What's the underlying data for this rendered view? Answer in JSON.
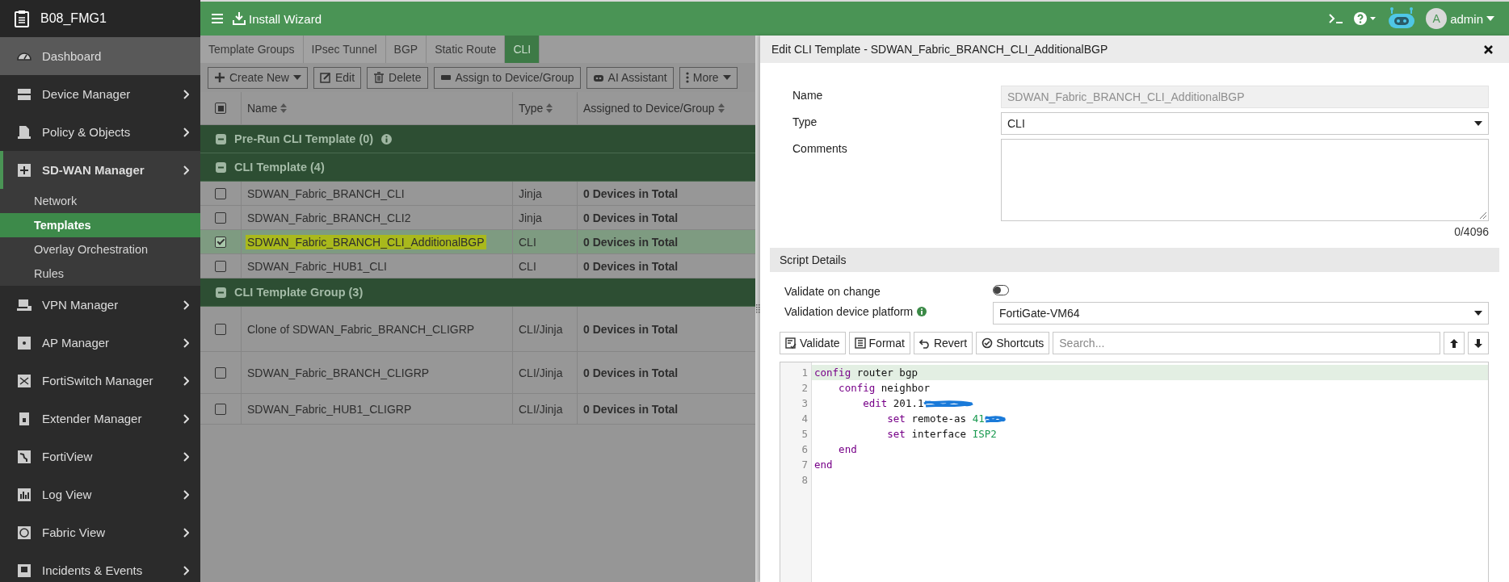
{
  "sidebar": {
    "title": "B08_FMG1",
    "items": [
      {
        "label": "Dashboard",
        "highlighted": true,
        "active": false,
        "submenu": false,
        "expanded": false
      },
      {
        "label": "Device Manager",
        "highlighted": false,
        "active": false,
        "submenu": true,
        "expanded": false
      },
      {
        "label": "Policy & Objects",
        "highlighted": false,
        "active": false,
        "submenu": true,
        "expanded": false
      },
      {
        "label": "SD-WAN Manager",
        "highlighted": false,
        "active": true,
        "submenu": true,
        "expanded": true,
        "children": [
          {
            "label": "Network",
            "selected": false
          },
          {
            "label": "Templates",
            "selected": true
          },
          {
            "label": "Overlay Orchestration",
            "selected": false
          },
          {
            "label": "Rules",
            "selected": false
          }
        ]
      },
      {
        "label": "VPN Manager",
        "highlighted": false,
        "active": false,
        "submenu": true,
        "expanded": false
      },
      {
        "label": "AP Manager",
        "highlighted": false,
        "active": false,
        "submenu": true,
        "expanded": false
      },
      {
        "label": "FortiSwitch Manager",
        "highlighted": false,
        "active": false,
        "submenu": true,
        "expanded": false
      },
      {
        "label": "Extender Manager",
        "highlighted": false,
        "active": false,
        "submenu": true,
        "expanded": false
      },
      {
        "label": "FortiView",
        "highlighted": false,
        "active": false,
        "submenu": true,
        "expanded": false
      },
      {
        "label": "Log View",
        "highlighted": false,
        "active": false,
        "submenu": true,
        "expanded": false
      },
      {
        "label": "Fabric View",
        "highlighted": false,
        "active": false,
        "submenu": true,
        "expanded": false
      },
      {
        "label": "Incidents & Events",
        "highlighted": false,
        "active": false,
        "submenu": true,
        "expanded": false
      }
    ]
  },
  "topbar": {
    "title": "Install Wizard",
    "avatar": "A",
    "user": "admin"
  },
  "tabs": [
    {
      "label": "Template Groups",
      "selected": false
    },
    {
      "label": "IPsec Tunnel",
      "selected": false
    },
    {
      "label": "BGP",
      "selected": false
    },
    {
      "label": "Static Route",
      "selected": false
    },
    {
      "label": "CLI",
      "selected": true
    }
  ],
  "toolbar": [
    {
      "kind": "create",
      "label": "Create New"
    },
    {
      "kind": "edit",
      "label": "Edit"
    },
    {
      "kind": "delete",
      "label": "Delete"
    },
    {
      "kind": "assign",
      "label": "Assign to Device/Group"
    },
    {
      "kind": "ai",
      "label": "AI Assistant"
    },
    {
      "kind": "more",
      "label": "More"
    }
  ],
  "table": {
    "select_all": {
      "indeterminate": true
    },
    "columns": [
      "Name",
      "Type",
      "Assigned to Device/Group"
    ],
    "groups": [
      {
        "title": "Pre-Run CLI Template (0)",
        "expanded": true,
        "info": true
      },
      {
        "title": "CLI Template (4)",
        "expanded": true,
        "info": false,
        "rows": [
          {
            "name": "SDWAN_Fabric_BRANCH_CLI",
            "type": "Jinja",
            "assigned": "0 Devices in Total",
            "checked": false,
            "selected": false,
            "highlighted": false
          },
          {
            "name": "SDWAN_Fabric_BRANCH_CLI2",
            "type": "Jinja",
            "assigned": "0 Devices in Total",
            "checked": false,
            "selected": false,
            "highlighted": false
          },
          {
            "name": "SDWAN_Fabric_BRANCH_CLI_AdditionalBGP",
            "type": "CLI",
            "assigned": "0 Devices in Total",
            "checked": true,
            "selected": true,
            "highlighted": true
          },
          {
            "name": "SDWAN_Fabric_HUB1_CLI",
            "type": "CLI",
            "assigned": "0 Devices in Total",
            "checked": false,
            "selected": false,
            "highlighted": false
          }
        ]
      },
      {
        "title": "CLI Template Group (3)",
        "expanded": true,
        "info": false,
        "rows": [
          {
            "name": "Clone of SDWAN_Fabric_BRANCH_CLIGRP",
            "type": "CLI/Jinja",
            "assigned": "0 Devices in Total",
            "checked": false,
            "selected": false,
            "highlighted": false
          },
          {
            "name": "SDWAN_Fabric_BRANCH_CLIGRP",
            "type": "CLI/Jinja",
            "assigned": "0 Devices in Total",
            "checked": false,
            "selected": false,
            "highlighted": false
          },
          {
            "name": "SDWAN_Fabric_HUB1_CLIGRP",
            "type": "CLI/Jinja",
            "assigned": "0 Devices in Total",
            "checked": false,
            "selected": false,
            "highlighted": false
          }
        ]
      }
    ]
  },
  "panel": {
    "title": "Edit CLI Template - SDWAN_Fabric_BRANCH_CLI_AdditionalBGP",
    "name": {
      "label": "Name",
      "value": "SDWAN_Fabric_BRANCH_CLI_AdditionalBGP",
      "disabled": true
    },
    "type": {
      "label": "Type",
      "value": "CLI"
    },
    "comments": {
      "label": "Comments",
      "counter": "0/4096"
    },
    "section": "Script Details",
    "validate_on_change": {
      "label": "Validate on change",
      "on": false
    },
    "platform": {
      "label": "Validation device platform",
      "value": "FortiGate-VM64"
    },
    "editor_buttons": [
      {
        "kind": "validate",
        "label": "Validate"
      },
      {
        "kind": "format",
        "label": "Format"
      },
      {
        "kind": "revert",
        "label": "Revert"
      },
      {
        "kind": "shortcuts",
        "label": "Shortcuts"
      }
    ],
    "search": {
      "placeholder": "Search..."
    },
    "code": [
      {
        "number": "1",
        "active": true,
        "redacted": false,
        "tokens": [
          {
            "kind": "keyword",
            "text": "config"
          },
          {
            "kind": "plain",
            "text": " router bgp"
          }
        ]
      },
      {
        "number": "2",
        "active": false,
        "redacted": false,
        "tokens": [
          {
            "kind": "keyword",
            "text": "    config"
          },
          {
            "kind": "plain",
            "text": " neighbor"
          }
        ]
      },
      {
        "number": "3",
        "active": false,
        "redacted": true,
        "tokens": [
          {
            "kind": "keyword",
            "text": "        edit"
          },
          {
            "kind": "plain",
            "text": " 201.1"
          }
        ]
      },
      {
        "number": "4",
        "active": false,
        "redacted": true,
        "tokens": [
          {
            "kind": "keyword",
            "text": "            set"
          },
          {
            "kind": "plain",
            "text": " remote-as "
          },
          {
            "kind": "value",
            "text": "41"
          }
        ]
      },
      {
        "number": "5",
        "active": false,
        "redacted": false,
        "tokens": [
          {
            "kind": "keyword",
            "text": "            set"
          },
          {
            "kind": "plain",
            "text": " interface "
          },
          {
            "kind": "value",
            "text": "ISP2"
          }
        ]
      },
      {
        "number": "6",
        "active": false,
        "redacted": false,
        "tokens": [
          {
            "kind": "keyword",
            "text": "    end"
          }
        ]
      },
      {
        "number": "7",
        "active": false,
        "redacted": false,
        "tokens": [
          {
            "kind": "keyword",
            "text": "end"
          }
        ]
      },
      {
        "number": "8",
        "active": false,
        "redacted": false
      }
    ]
  }
}
